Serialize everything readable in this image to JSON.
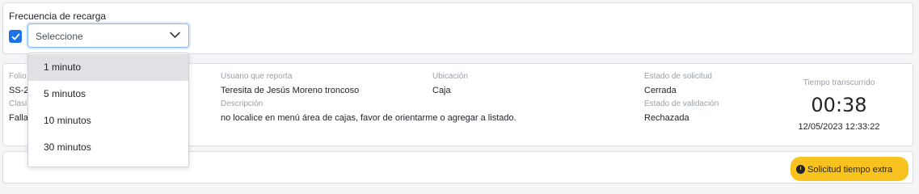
{
  "refresh": {
    "label": "Frecuencia de recarga",
    "checkbox_checked": true,
    "select_placeholder": "Seleccione",
    "options": [
      "1 minuto",
      "5 minutos",
      "10 minutos",
      "30 minutos"
    ],
    "highlighted_option": "1 minuto"
  },
  "request": {
    "folio_label": "Folio",
    "folio_value": "SS-2",
    "classification_label": "Clasi",
    "classification_value": "Falla",
    "reporter_label": "Usuario que reporta",
    "reporter_value": "Teresita de Jesús Moreno troncoso",
    "description_label": "Descripción",
    "description_value": "no localice en menú área de cajas, favor de orientarme o agregar a listado.",
    "location_label": "Ubicación",
    "location_value": "Caja",
    "status_label": "Estado de solicitud",
    "status_value": "Cerrada",
    "validation_label": "Estado de validación",
    "validation_value": "Rechazada",
    "elapsed_label": "Tiempo transcurrido",
    "elapsed_value": "00:38",
    "datetime_value": "12/05/2023 12:33:22"
  },
  "badge": {
    "text": "Solicitud tiempo extra",
    "color": "#f9c31f"
  },
  "colors": {
    "accent": "#1a73e8",
    "badge": "#f9c31f",
    "muted_label": "#9aa0a6"
  }
}
